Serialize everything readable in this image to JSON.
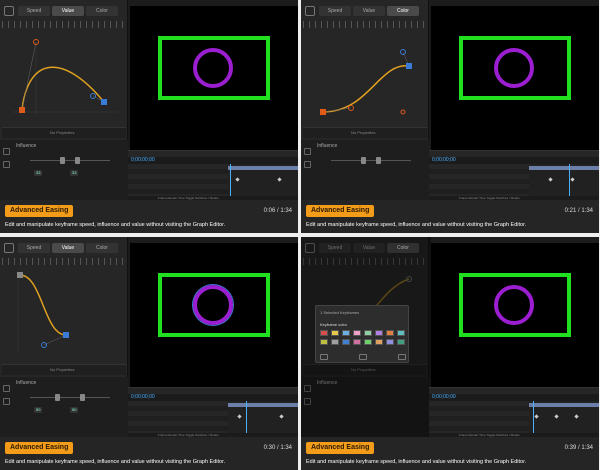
{
  "tabs": [
    "Speed",
    "Value",
    "Color"
  ],
  "properties_label": "No Properties",
  "influence_label": "Influence",
  "selected_keyframes_label": "1 Selected Keyframes",
  "keyframe_color_label": "Keyframe color",
  "tl_time": "0;00;00;00",
  "tl_footer": "Frame Render Time   Toggle Switches / Modes",
  "accent": "#f39c1a",
  "cards": [
    {
      "badge": "Advanced Easing",
      "time": "0:06 / 1:34",
      "desc": "Edit and manipulate keyframe speed, influence and value without visiting the Graph Editor.",
      "active_tab": 1
    },
    {
      "badge": "Advanced Easing",
      "time": "0:21 / 1:34",
      "desc": "Edit and manipulate keyframe speed, influence and value without visiting the Graph Editor.",
      "active_tab": 2
    },
    {
      "badge": "Advanced Easing",
      "time": "0:30 / 1:34",
      "desc": "Edit and manipulate keyframe speed, influence and value without visiting the Graph Editor.",
      "active_tab": 1
    },
    {
      "badge": "Advanced Easing",
      "time": "0:39 / 1:34",
      "desc": "Edit and manipulate keyframe speed, influence and value without visiting the Graph Editor.",
      "active_tab": 2
    }
  ],
  "swatch_colors": [
    "#d94c4c",
    "#e6c84a",
    "#6ab0e0",
    "#f0a0c8",
    "#8fd0a0",
    "#b080e0",
    "#e08040",
    "#60c0c0",
    "#c0c040",
    "#a0a0a0",
    "#4080d0",
    "#d070a0",
    "#70d070",
    "#e0a060",
    "#9090e0",
    "#40a080"
  ]
}
